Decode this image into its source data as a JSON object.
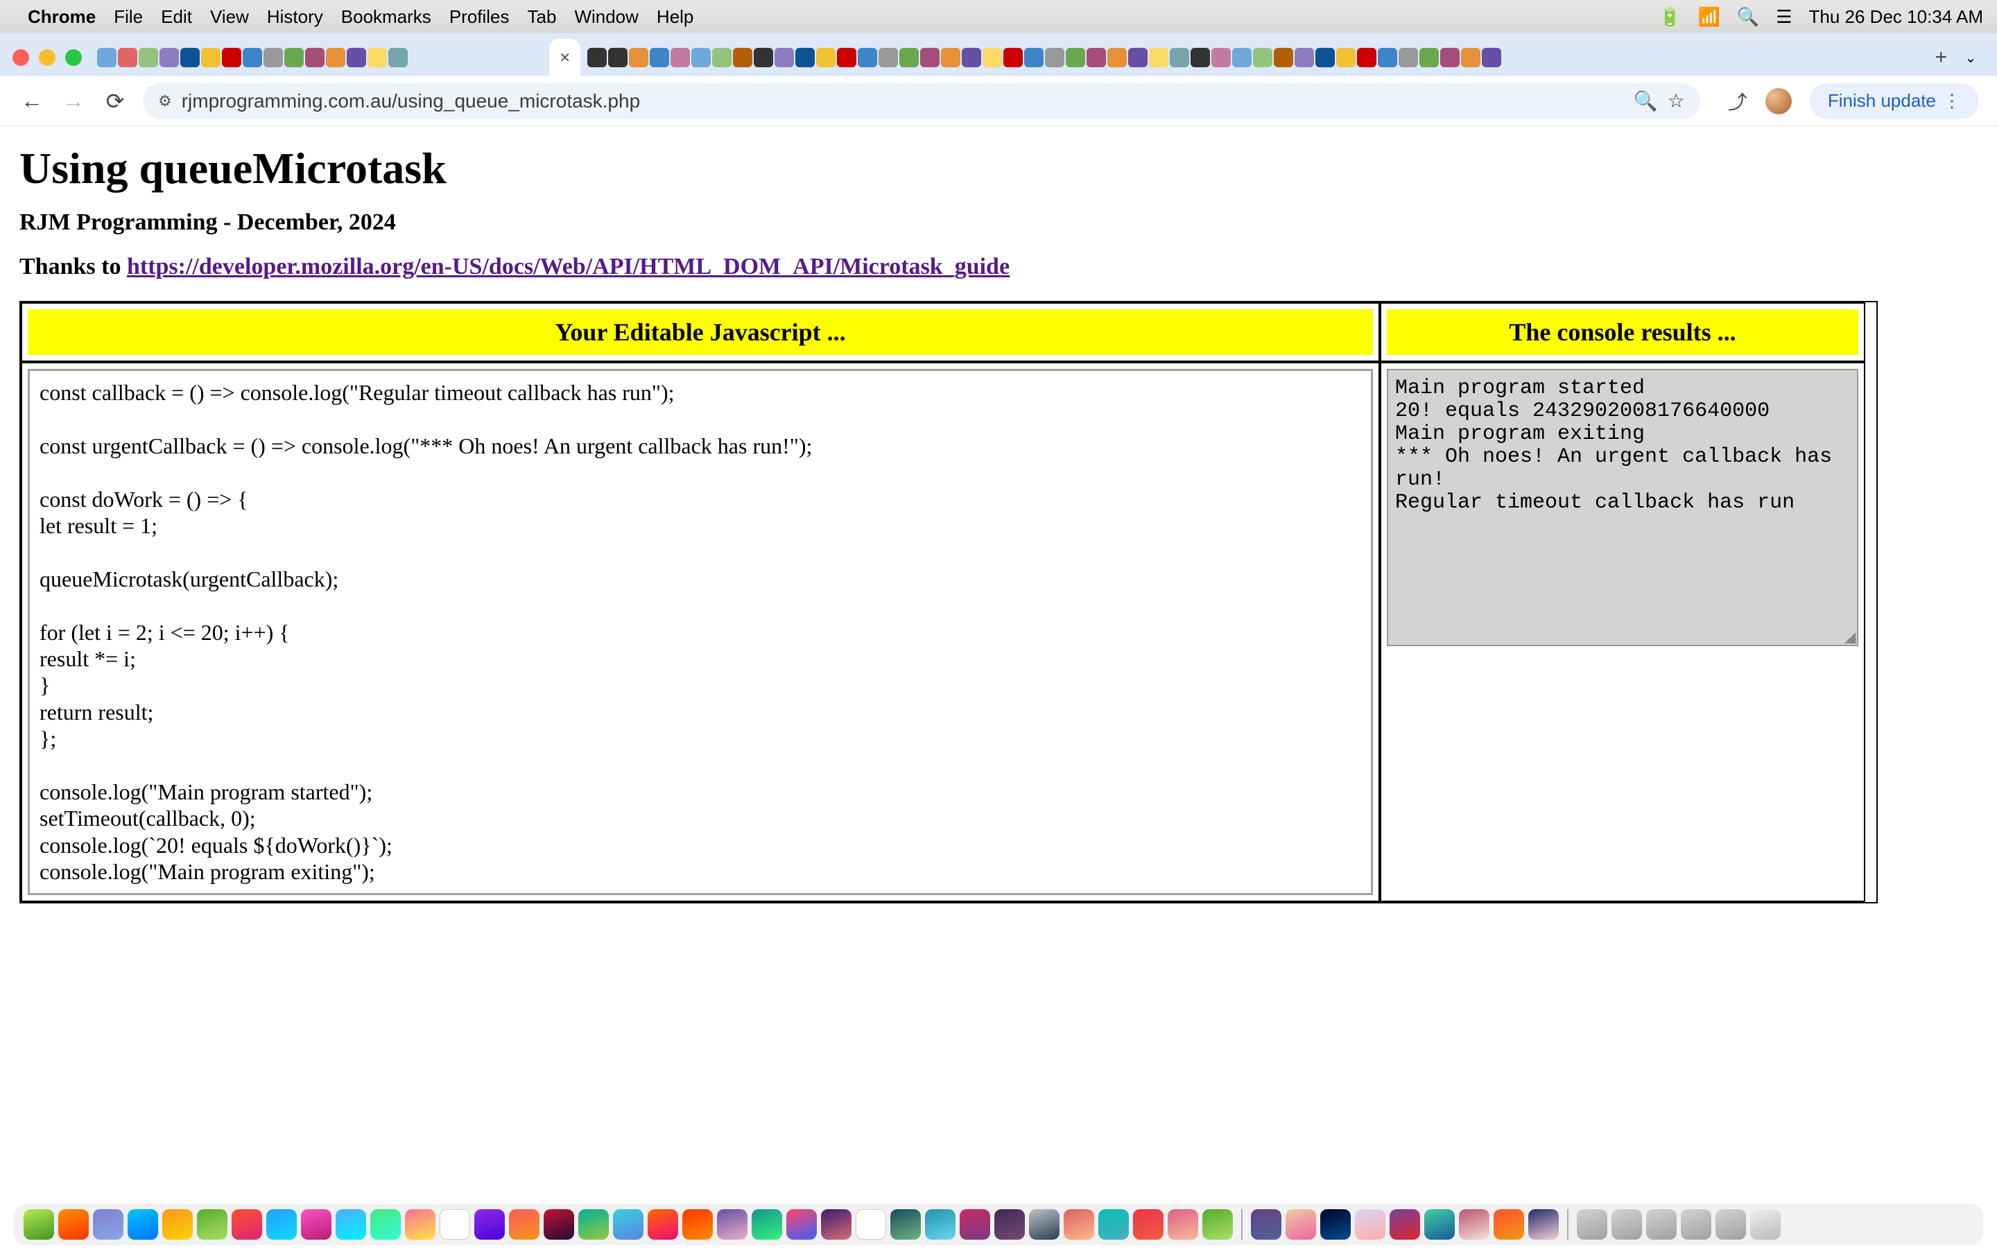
{
  "menubar": {
    "app": "Chrome",
    "items": [
      "File",
      "Edit",
      "View",
      "History",
      "Bookmarks",
      "Profiles",
      "Tab",
      "Window",
      "Help"
    ],
    "clock": "Thu 26 Dec  10:34 AM"
  },
  "browser": {
    "url": "rjmprogramming.com.au/using_queue_microtask.php",
    "finish_update": "Finish update"
  },
  "page": {
    "title": "Using queueMicrotask",
    "subtitle": "RJM Programming - December, 2024",
    "thanks_label": "Thanks to ",
    "thanks_link_text": "https://developer.mozilla.org/en-US/docs/Web/API/HTML_DOM_API/Microtask_guide",
    "left_header": "Your Editable Javascript ...",
    "right_header": "The console results ...",
    "code": "const callback = () => console.log(\"Regular timeout callback has run\");\n\nconst urgentCallback = () => console.log(\"*** Oh noes! An urgent callback has run!\");\n\nconst doWork = () => {\nlet result = 1;\n\nqueueMicrotask(urgentCallback);\n\nfor (let i = 2; i <= 20; i++) {\nresult *= i;\n}\nreturn result;\n};\n\nconsole.log(\"Main program started\");\nsetTimeout(callback, 0);\nconsole.log(`20! equals ${doWork()}`);\nconsole.log(\"Main program exiting\");",
    "console_output": "Main program started\n20! equals 2432902008176640000\nMain program exiting\n*** Oh noes! An urgent callback has run!\nRegular timeout callback has run"
  }
}
